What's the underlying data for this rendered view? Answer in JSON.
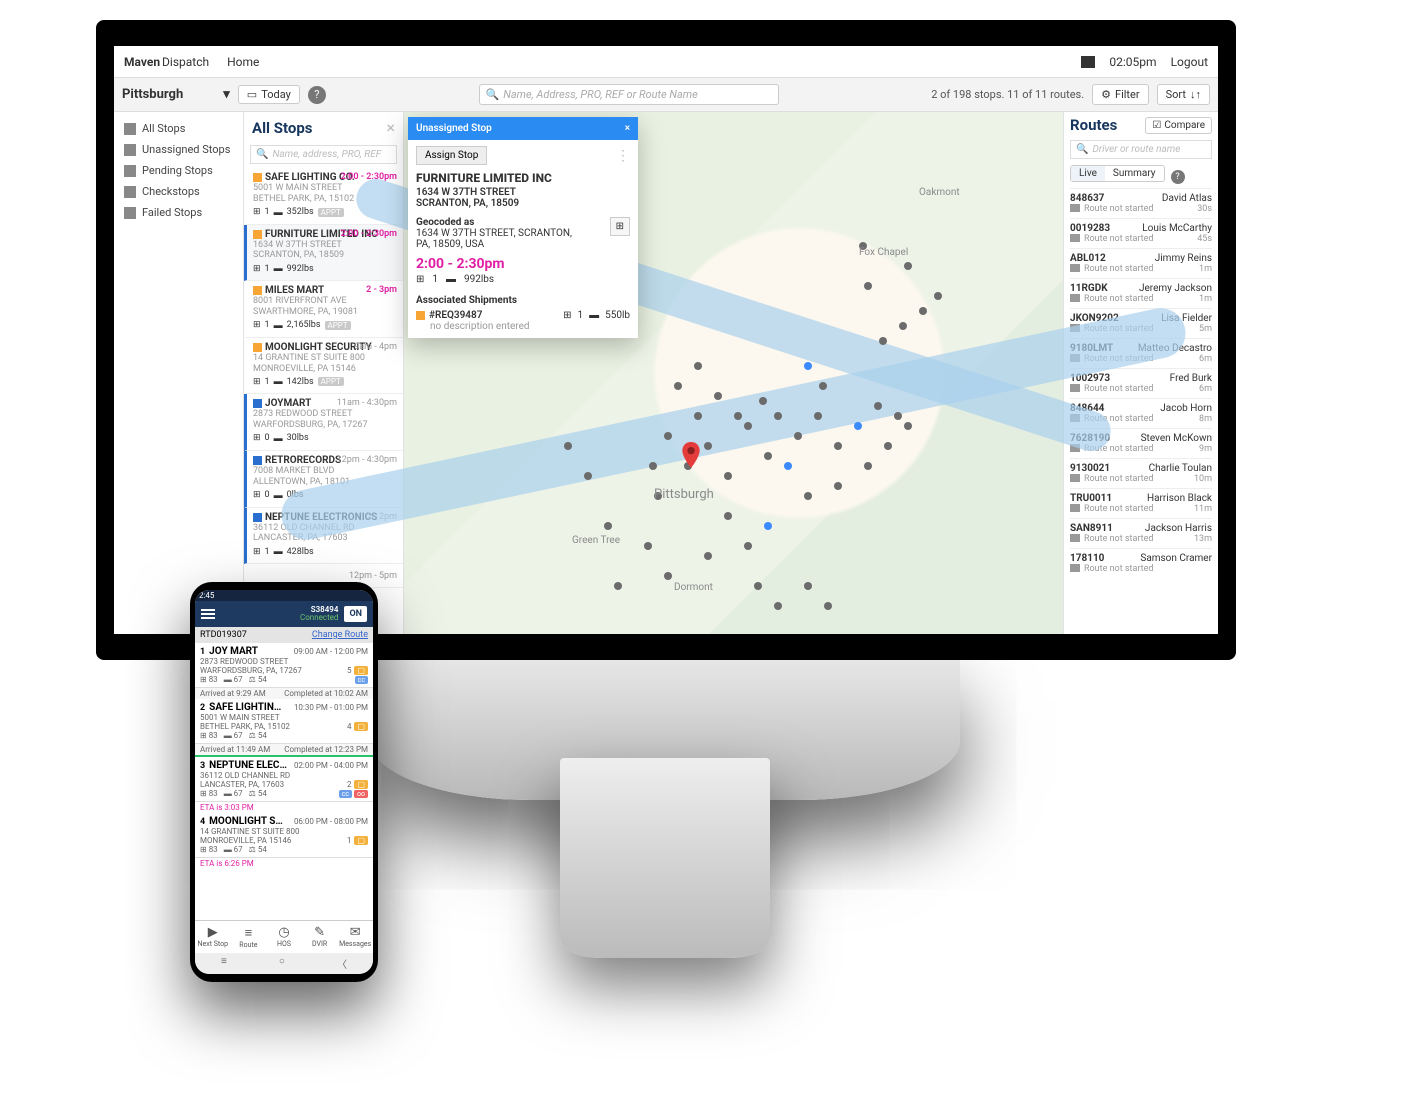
{
  "header": {
    "brand": "Maven",
    "product": "Dispatch",
    "home": "Home",
    "clock": "02:05pm",
    "logout": "Logout"
  },
  "filterbar": {
    "city": "Pittsburgh",
    "today": "Today",
    "search_placeholder": "Name, Address, PRO, REF or Route Name",
    "counts": "2 of 198 stops. 11 of 11 routes.",
    "filter": "Filter",
    "sort": "Sort"
  },
  "sidebar": {
    "items": [
      {
        "label": "All Stops"
      },
      {
        "label": "Unassigned Stops"
      },
      {
        "label": "Pending Stops"
      },
      {
        "label": "Checkstops"
      },
      {
        "label": "Failed Stops"
      }
    ]
  },
  "stops": {
    "title": "All Stops",
    "search_placeholder": "Name, address, PRO, REF",
    "items": [
      {
        "kind": "o",
        "name": "SAFE LIGHTING CO.",
        "addr1": "5001 W MAIN STREET",
        "addr2": "BETHEL PARK, PA, 15102",
        "qty": "1",
        "wt": "352lbs",
        "appt": true,
        "time": "2:00 - 2:30pm",
        "time_cls": "pink"
      },
      {
        "kind": "o",
        "sel": true,
        "name": "FURNITURE LIMITED INC",
        "addr1": "1634 W 37TH STREET",
        "addr2": "SCRANTON, PA, 18509",
        "qty": "1",
        "wt": "992lbs",
        "time": "2:00 - 2:30pm",
        "time_cls": "pink"
      },
      {
        "kind": "o",
        "name": "MILES MART",
        "addr1": "8001 RIVERFRONT AVE",
        "addr2": "SWARTHMORE, PA, 19081",
        "qty": "1",
        "wt": "2,165lbs",
        "appt": true,
        "time": "2 - 3pm",
        "time_cls": "pink"
      },
      {
        "kind": "o",
        "name": "MOONLIGHT SECURITY",
        "addr1": "14 GRANTINE ST SUITE 800",
        "addr2": "MONROEVILLE, PA 15146",
        "qty": "1",
        "wt": "142lbs",
        "appt": true,
        "time": "9am - 4pm",
        "time_cls": "grey"
      },
      {
        "kind": "b",
        "blue": true,
        "name": "JOYMART",
        "addr1": "2873 REDWOOD STREET",
        "addr2": "WARFORDSBURG, PA, 17267",
        "qty": "0",
        "wt": "30lbs",
        "time": "11am - 4:30pm",
        "time_cls": "grey"
      },
      {
        "kind": "b",
        "blue": true,
        "name": "RETRORECORDS",
        "addr1": "7008 MARKET BLVD",
        "addr2": "ALLENTOWN, PA, 18101",
        "qty": "0",
        "wt": "0lbs",
        "time": "12pm - 4:30pm",
        "time_cls": "grey"
      },
      {
        "kind": "b",
        "blue": true,
        "name": "NEPTUNE ELECTRONICS",
        "addr1": "36112 OLD CHANNEL RD",
        "addr2": "LANCASTER, PA, 17603",
        "qty": "1",
        "wt": "428lbs",
        "time": "2 - 2pm",
        "time_cls": "grey"
      }
    ],
    "more_time": "12pm - 5pm"
  },
  "popup": {
    "title": "Unassigned Stop",
    "assign": "Assign Stop",
    "company": "FURNITURE LIMITED INC",
    "addr1": "1634 W 37TH STREET",
    "addr2": "SCRANTON, PA, 18509",
    "geocoded_label": "Geocoded as",
    "geocoded": "1634 W 37TH STREET, SCRANTON, PA, 18509, USA",
    "time": "2:00 - 2:30pm",
    "qty": "1",
    "wt": "992lbs",
    "assoc_label": "Associated Shipments",
    "ship_ref": "#REQ39487",
    "ship_qty": "1",
    "ship_wt": "550lb",
    "ship_desc": "no description entered"
  },
  "routes": {
    "title": "Routes",
    "compare": "Compare",
    "search_placeholder": "Driver or route name",
    "seg_live": "Live",
    "seg_summary": "Summary",
    "not_started": "Route not started",
    "items": [
      {
        "id": "848637",
        "driver": "David Atlas",
        "eta": "30s"
      },
      {
        "id": "0019283",
        "driver": "Louis McCarthy",
        "eta": "45s"
      },
      {
        "id": "ABL012",
        "driver": "Jimmy Reins",
        "eta": "1m"
      },
      {
        "id": "11RGDK",
        "driver": "Jeremy Jackson",
        "eta": "1m"
      },
      {
        "id": "JKON9202",
        "driver": "Lisa Fielder",
        "eta": "5m"
      },
      {
        "id": "9180LMT",
        "driver": "Matteo Decastro",
        "eta": "6m"
      },
      {
        "id": "1002973",
        "driver": "Fred Burk",
        "eta": "6m"
      },
      {
        "id": "848644",
        "driver": "Jacob Horn",
        "eta": "8m"
      },
      {
        "id": "7628190",
        "driver": "Steven McKown",
        "eta": "9m"
      },
      {
        "id": "9130021",
        "driver": "Charlie Toulan",
        "eta": "10m"
      },
      {
        "id": "TRU0011",
        "driver": "Harrison Black",
        "eta": "11m"
      },
      {
        "id": "SAN8911",
        "driver": "Jackson Harris",
        "eta": "13m"
      },
      {
        "id": "178110",
        "driver": "Samson Cramer",
        "eta": ""
      }
    ]
  },
  "phone": {
    "status_time": "2:45",
    "veh": "S38494",
    "conn": "Connected",
    "on": "ON",
    "route_id": "RTD019307",
    "change_route": "Change Route",
    "stops": [
      {
        "num": "1",
        "name": "JOY MART",
        "time": "09:00 AM - 12:00 PM",
        "addr1": "2873 REDWOOD STREET",
        "addr2": "WARFORDSBURG, PA, 17267",
        "m1": "83",
        "m2": "67",
        "m3": "54",
        "cnt": "5",
        "arr": "Arrived at 9:29 AM",
        "comp": "Completed at 10:02 AM",
        "cc": true
      },
      {
        "num": "2",
        "name": "SAFE LIGHTING …",
        "time": "10:30 PM - 01:00 PM",
        "addr1": "5001 W MAIN STREET",
        "addr2": "BETHEL PARK, PA, 15102",
        "m1": "83",
        "m2": "67",
        "m3": "54",
        "cnt": "4",
        "arr": "Arrived at 11:49 AM",
        "comp": "Completed at 12:23 PM",
        "green": true
      },
      {
        "num": "3",
        "name": "NEPTUNE ELEC…",
        "time": "02:00 PM - 04:00 PM",
        "addr1": "36112 OLD CHANNEL RD",
        "addr2": "LANCASTER, PA, 17603",
        "m1": "83",
        "m2": "67",
        "m3": "54",
        "cnt": "2",
        "eta": "ETA is 3:03 PM",
        "cc": true,
        "oo": true
      },
      {
        "num": "4",
        "name": "MOONLIGHT SEC…",
        "time": "06:00 PM - 08:00 PM",
        "addr1": "14 GRANTINE ST SUITE 800",
        "addr2": "MONROEVILLE, PA 15146",
        "m1": "83",
        "m2": "67",
        "m3": "54",
        "cnt": "1",
        "eta": "ETA is 6:26 PM"
      }
    ],
    "tabs": [
      {
        "label": "Next Stop",
        "icon": "▶"
      },
      {
        "label": "Route",
        "icon": "≡"
      },
      {
        "label": "HOS",
        "icon": "◷"
      },
      {
        "label": "DVIR",
        "icon": "✎"
      },
      {
        "label": "Messages",
        "icon": "✉"
      }
    ]
  }
}
